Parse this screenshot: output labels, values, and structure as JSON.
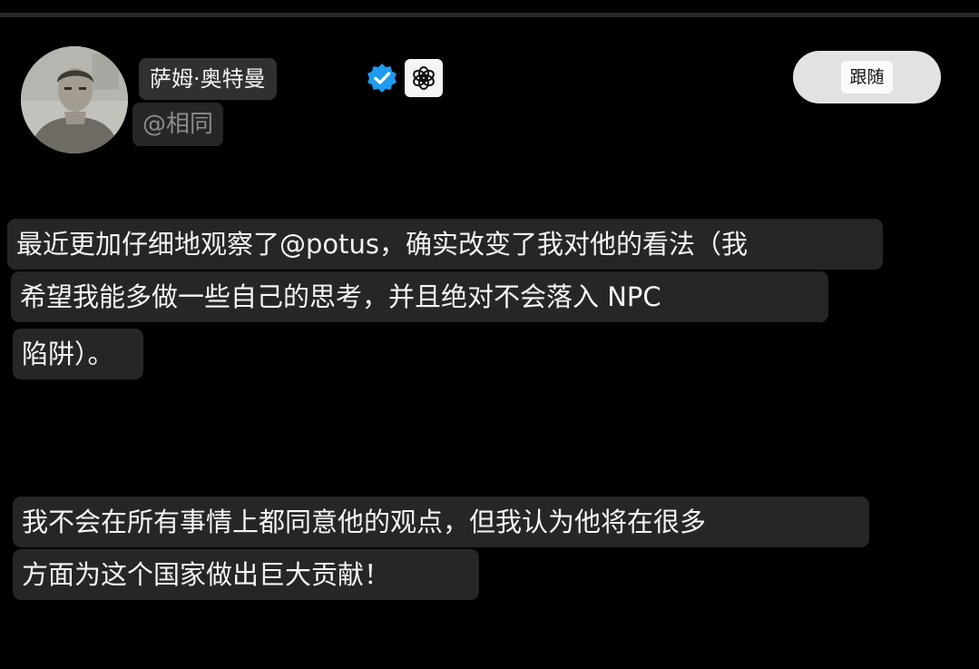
{
  "profile": {
    "display_name": "萨姆·奥特曼",
    "handle": "@相同",
    "verified_icon": "verified-check-icon",
    "org_badge_icon": "openai-logo-icon",
    "avatar_icon": "profile-photo"
  },
  "follow_button": {
    "label": "跟随"
  },
  "tweet": {
    "lines": [
      "最近更加仔细地观察了@potus，确实改变了我对他的看法（我",
      "希望我能多做一些自己的思考，并且绝对不会落入 NPC",
      "陷阱）。",
      "我不会在所有事情上都同意他的观点，但我认为他将在很多",
      "方面为这个国家做出巨大贡献！"
    ]
  },
  "colors": {
    "background": "#000000",
    "text_highlight": "#262626",
    "verified_blue": "#1d9bf0",
    "follow_button_bg": "#e2e2e2"
  }
}
